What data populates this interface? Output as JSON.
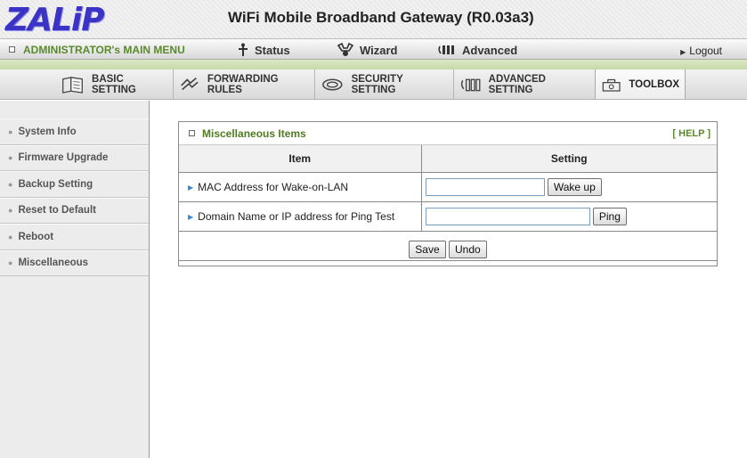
{
  "brand": {
    "logo": "ZALiP",
    "title": "WiFi Mobile Broadband Gateway (R0.03a3)"
  },
  "menubar": {
    "admin_label": "ADMINISTRATOR's MAIN MENU",
    "items": [
      {
        "label": "Status",
        "icon": "status-icon"
      },
      {
        "label": "Wizard",
        "icon": "wizard-icon"
      },
      {
        "label": "Advanced",
        "icon": "advanced-icon"
      }
    ],
    "logout": "Logout"
  },
  "tabs": [
    {
      "label": "BASIC SETTING",
      "icon": "basic-setting-icon"
    },
    {
      "label": "FORWARDING RULES",
      "icon": "forwarding-rules-icon"
    },
    {
      "label": "SECURITY SETTING",
      "icon": "security-setting-icon"
    },
    {
      "label": "ADVANCED SETTING",
      "icon": "advanced-setting-icon"
    },
    {
      "label": "TOOLBOX",
      "icon": "toolbox-icon",
      "active": true
    }
  ],
  "sidebar": {
    "items": [
      {
        "label": "System Info"
      },
      {
        "label": "Firmware Upgrade"
      },
      {
        "label": "Backup Setting"
      },
      {
        "label": "Reset to Default"
      },
      {
        "label": "Reboot"
      },
      {
        "label": "Miscellaneous"
      }
    ]
  },
  "panel": {
    "title": "Miscellaneous Items",
    "help": "[ HELP ]",
    "columns": {
      "item": "Item",
      "setting": "Setting"
    },
    "rows": [
      {
        "label": "MAC Address for Wake-on-LAN",
        "value": "",
        "button": "Wake up"
      },
      {
        "label": "Domain Name or IP address for Ping Test",
        "value": "",
        "button": "Ping"
      }
    ],
    "save": "Save",
    "undo": "Undo"
  },
  "colors": {
    "logo": "#3b33c5",
    "accent_green": "#5a8a2a",
    "link_blue": "#3b8ad8"
  }
}
